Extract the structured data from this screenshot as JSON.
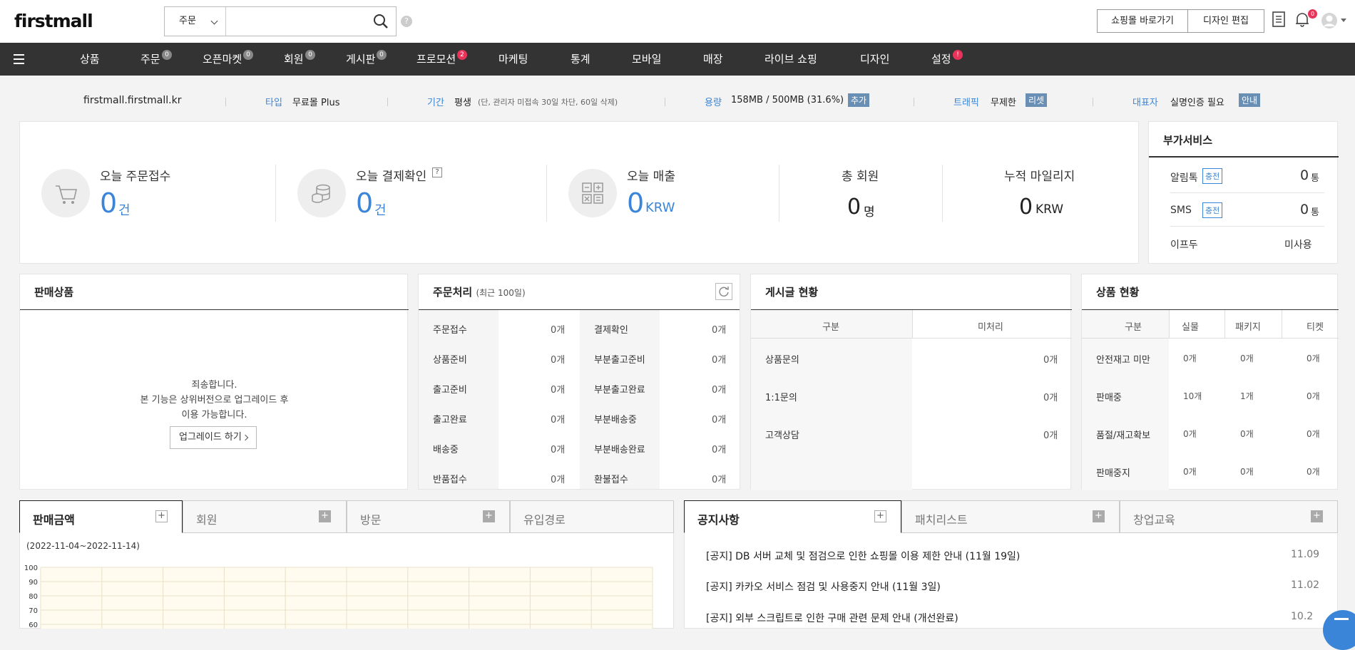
{
  "brand": "firstmall",
  "search": {
    "select": "주문",
    "placeholder": ""
  },
  "top_buttons": {
    "shop": "쇼핑몰 바로가기",
    "design": "디자인 편집"
  },
  "notif_count": "0",
  "nav": [
    {
      "label": "상품",
      "badge": ""
    },
    {
      "label": "주문",
      "badge": "0"
    },
    {
      "label": "오픈마켓",
      "badge": "0"
    },
    {
      "label": "회원",
      "badge": "0"
    },
    {
      "label": "게시판",
      "badge": "0"
    },
    {
      "label": "프로모션",
      "badge": "2"
    },
    {
      "label": "마케팅",
      "badge": ""
    },
    {
      "label": "통계",
      "badge": ""
    },
    {
      "label": "모바일",
      "badge": ""
    },
    {
      "label": "매장",
      "badge": ""
    },
    {
      "label": "라이브 쇼핑",
      "badge": ""
    },
    {
      "label": "디자인",
      "badge": ""
    },
    {
      "label": "설정",
      "badge": "!"
    }
  ],
  "info": {
    "domain": "firstmall.firstmall.kr",
    "type_label": "타입",
    "type_value": "무료몰 Plus",
    "period_label": "기간",
    "period_value": "평생",
    "period_note": "(단, 관리자 미접속 30일 차단, 60일 삭제)",
    "capacity_label": "용량",
    "capacity_value": "158MB / 500MB (31.6%)",
    "capacity_tag": "추가",
    "traffic_label": "트래픽",
    "traffic_value": "무제한",
    "traffic_tag": "리셋",
    "ceo_label": "대표자",
    "ceo_value": "실명인증 필요",
    "ceo_tag": "안내"
  },
  "stats": {
    "orders": {
      "title": "오늘 주문접수",
      "value": "0",
      "unit": "건"
    },
    "payments": {
      "title": "오늘 결제확인",
      "help": "?",
      "value": "0",
      "unit": "건"
    },
    "sales": {
      "title": "오늘 매출",
      "value": "0",
      "unit": "KRW"
    },
    "members": {
      "title": "총 회원",
      "value": "0",
      "unit": "명"
    },
    "mileage": {
      "title": "누적 마일리지",
      "value": "0",
      "unit": "KRW"
    }
  },
  "addon": {
    "title": "부가서비스",
    "rows": [
      {
        "label": "알림톡",
        "tag": "충전",
        "value": "0",
        "unit": "통"
      },
      {
        "label": "SMS",
        "tag": "충전",
        "value": "0",
        "unit": "통"
      },
      {
        "label": "이프두",
        "tag": "",
        "value": "미사용",
        "unit": ""
      }
    ]
  },
  "selling": {
    "title": "판매상품",
    "msg1": "죄송합니다.",
    "msg2": "본 기능은 상위버전으로 업그레이드 후",
    "msg3": "이용 가능합니다.",
    "button": "업그레이드 하기"
  },
  "order_proc": {
    "title": "주문처리",
    "sub": "(최근 100일)",
    "rows": [
      [
        "주문접수",
        "0개",
        "결제확인",
        "0개"
      ],
      [
        "상품준비",
        "0개",
        "부분출고준비",
        "0개"
      ],
      [
        "출고준비",
        "0개",
        "부분출고완료",
        "0개"
      ],
      [
        "출고완료",
        "0개",
        "부분배송중",
        "0개"
      ],
      [
        "배송중",
        "0개",
        "부분배송완료",
        "0개"
      ],
      [
        "반품접수",
        "0개",
        "환불접수",
        "0개"
      ]
    ]
  },
  "board": {
    "title": "게시글 현황",
    "cols": [
      "구분",
      "미처리"
    ],
    "rows": [
      [
        "상품문의",
        "0개"
      ],
      [
        "1:1문의",
        "0개"
      ],
      [
        "고객상담",
        "0개"
      ]
    ]
  },
  "product": {
    "title": "상품 현황",
    "cols": [
      "구분",
      "실물",
      "패키지",
      "티켓"
    ],
    "rows": [
      [
        "안전재고 미만",
        "0개",
        "0개",
        "0개"
      ],
      [
        "판매중",
        "10개",
        "1개",
        "0개"
      ],
      [
        "품절/재고확보",
        "0개",
        "0개",
        "0개"
      ],
      [
        "판매중지",
        "0개",
        "0개",
        "0개"
      ]
    ]
  },
  "tabs_left": [
    "판매금액",
    "회원",
    "방문",
    "유입경로"
  ],
  "chart": {
    "period": "(2022-11-04~2022-11-14)",
    "yticks": [
      "100",
      "90",
      "80",
      "70",
      "60"
    ]
  },
  "tabs_right": [
    "공지사항",
    "패치리스트",
    "창업교육"
  ],
  "notices": [
    {
      "text": "[공지] DB 서버 교체 및 점검으로 인한 쇼핑몰 이용 제한 안내 (11월 19일)",
      "date": "11.09"
    },
    {
      "text": "[공지] 카카오 서비스 점검 및 사용중지 안내 (11월 3일)",
      "date": "11.02"
    },
    {
      "text": "[공지] 외부 스크립트로 인한 구매 관련 문제 안내 (개선완료)",
      "date": "10.2"
    }
  ],
  "colors": {
    "accent": "#3b85d8",
    "nav_bg": "#333333",
    "badge_red": "#e8335a"
  }
}
